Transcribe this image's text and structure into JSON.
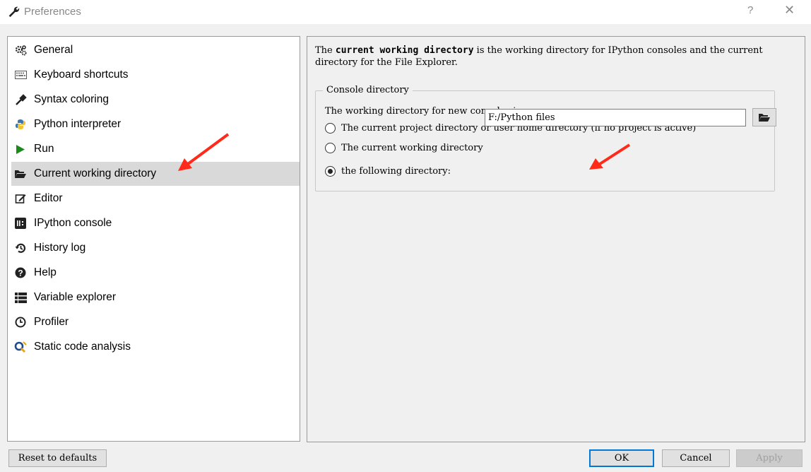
{
  "window": {
    "title": "Preferences",
    "help_label": "?",
    "close_label": "✕"
  },
  "sidebar": {
    "selected_index": 5,
    "items": [
      {
        "label": "General",
        "icon": "gears-icon"
      },
      {
        "label": "Keyboard shortcuts",
        "icon": "keyboard-icon"
      },
      {
        "label": "Syntax coloring",
        "icon": "eyedropper-icon"
      },
      {
        "label": "Python interpreter",
        "icon": "python-icon"
      },
      {
        "label": "Run",
        "icon": "play-icon"
      },
      {
        "label": "Current working directory",
        "icon": "folder-open-icon"
      },
      {
        "label": "Editor",
        "icon": "edit-icon"
      },
      {
        "label": "IPython console",
        "icon": "ipython-icon"
      },
      {
        "label": "History log",
        "icon": "history-icon"
      },
      {
        "label": "Help",
        "icon": "question-circle-icon"
      },
      {
        "label": "Variable explorer",
        "icon": "list-icon"
      },
      {
        "label": "Profiler",
        "icon": "clock-icon"
      },
      {
        "label": "Static code analysis",
        "icon": "pylint-icon"
      }
    ]
  },
  "main": {
    "description_prefix": "The ",
    "description_bold": "current working directory",
    "description_suffix": " is the working directory for IPython consoles and the current directory for the File Explorer.",
    "group_title": "Console directory",
    "intro": "The working directory for new consoles is:",
    "options": [
      {
        "label": "The current project directory or user home directory (if no project is active)",
        "checked": false
      },
      {
        "label": "The current working directory",
        "checked": false
      },
      {
        "label": "the following directory:",
        "checked": true
      }
    ],
    "directory_value": "F:/Python files"
  },
  "footer": {
    "reset_label": "Reset to defaults",
    "ok_label": "OK",
    "cancel_label": "Cancel",
    "apply_label": "Apply"
  },
  "colors": {
    "accent": "#0078d7",
    "annotation_arrow": "#ff2a1a",
    "selection": "#d9d9d9"
  }
}
